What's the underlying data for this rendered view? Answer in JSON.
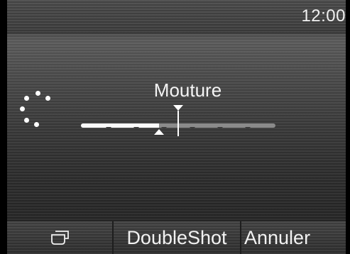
{
  "status_bar": {
    "clock": "12:00"
  },
  "setting": {
    "title": "Mouture",
    "level": 0.4,
    "target_level": 0.5,
    "tick_count": 6
  },
  "softkeys": {
    "cup_icon": "cup-icon",
    "double_shot": "DoubleShot",
    "cancel": "Annuler"
  },
  "colors": {
    "track_fill": "#fafafa",
    "track_empty": "#8a8a8a",
    "text": "#f2f2f2"
  }
}
